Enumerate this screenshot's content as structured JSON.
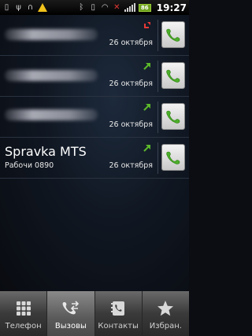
{
  "status_bar": {
    "time": "19:27",
    "battery": "86",
    "icons": [
      "sim-icon",
      "usb-icon",
      "headset-icon",
      "warning-icon",
      "bluetooth-icon",
      "vibrate-icon",
      "wifi-icon",
      "no-sim-icon",
      "signal-icon",
      "battery-icon"
    ]
  },
  "calls": [
    {
      "name": "",
      "number": "",
      "date": "26 октября",
      "direction": "missed",
      "color": "#e53935"
    },
    {
      "name": "",
      "number": "",
      "date": "26 октября",
      "direction": "outgoing",
      "color": "#5cb82a"
    },
    {
      "name": "",
      "number": "",
      "date": "26 октября",
      "direction": "outgoing",
      "color": "#5cb82a"
    },
    {
      "name": "Spravka MTS",
      "number": "Рабочи  0890",
      "date": "26 октября",
      "direction": "outgoing",
      "color": "#5cb82a"
    }
  ],
  "tabs": [
    {
      "label": "Телефон",
      "icon": "dialpad-icon",
      "active": false
    },
    {
      "label": "Вызовы",
      "icon": "call-log-icon",
      "active": true
    },
    {
      "label": "Контакты",
      "icon": "contacts-icon",
      "active": false
    },
    {
      "label": "Избран.",
      "icon": "star-icon",
      "active": false
    }
  ]
}
